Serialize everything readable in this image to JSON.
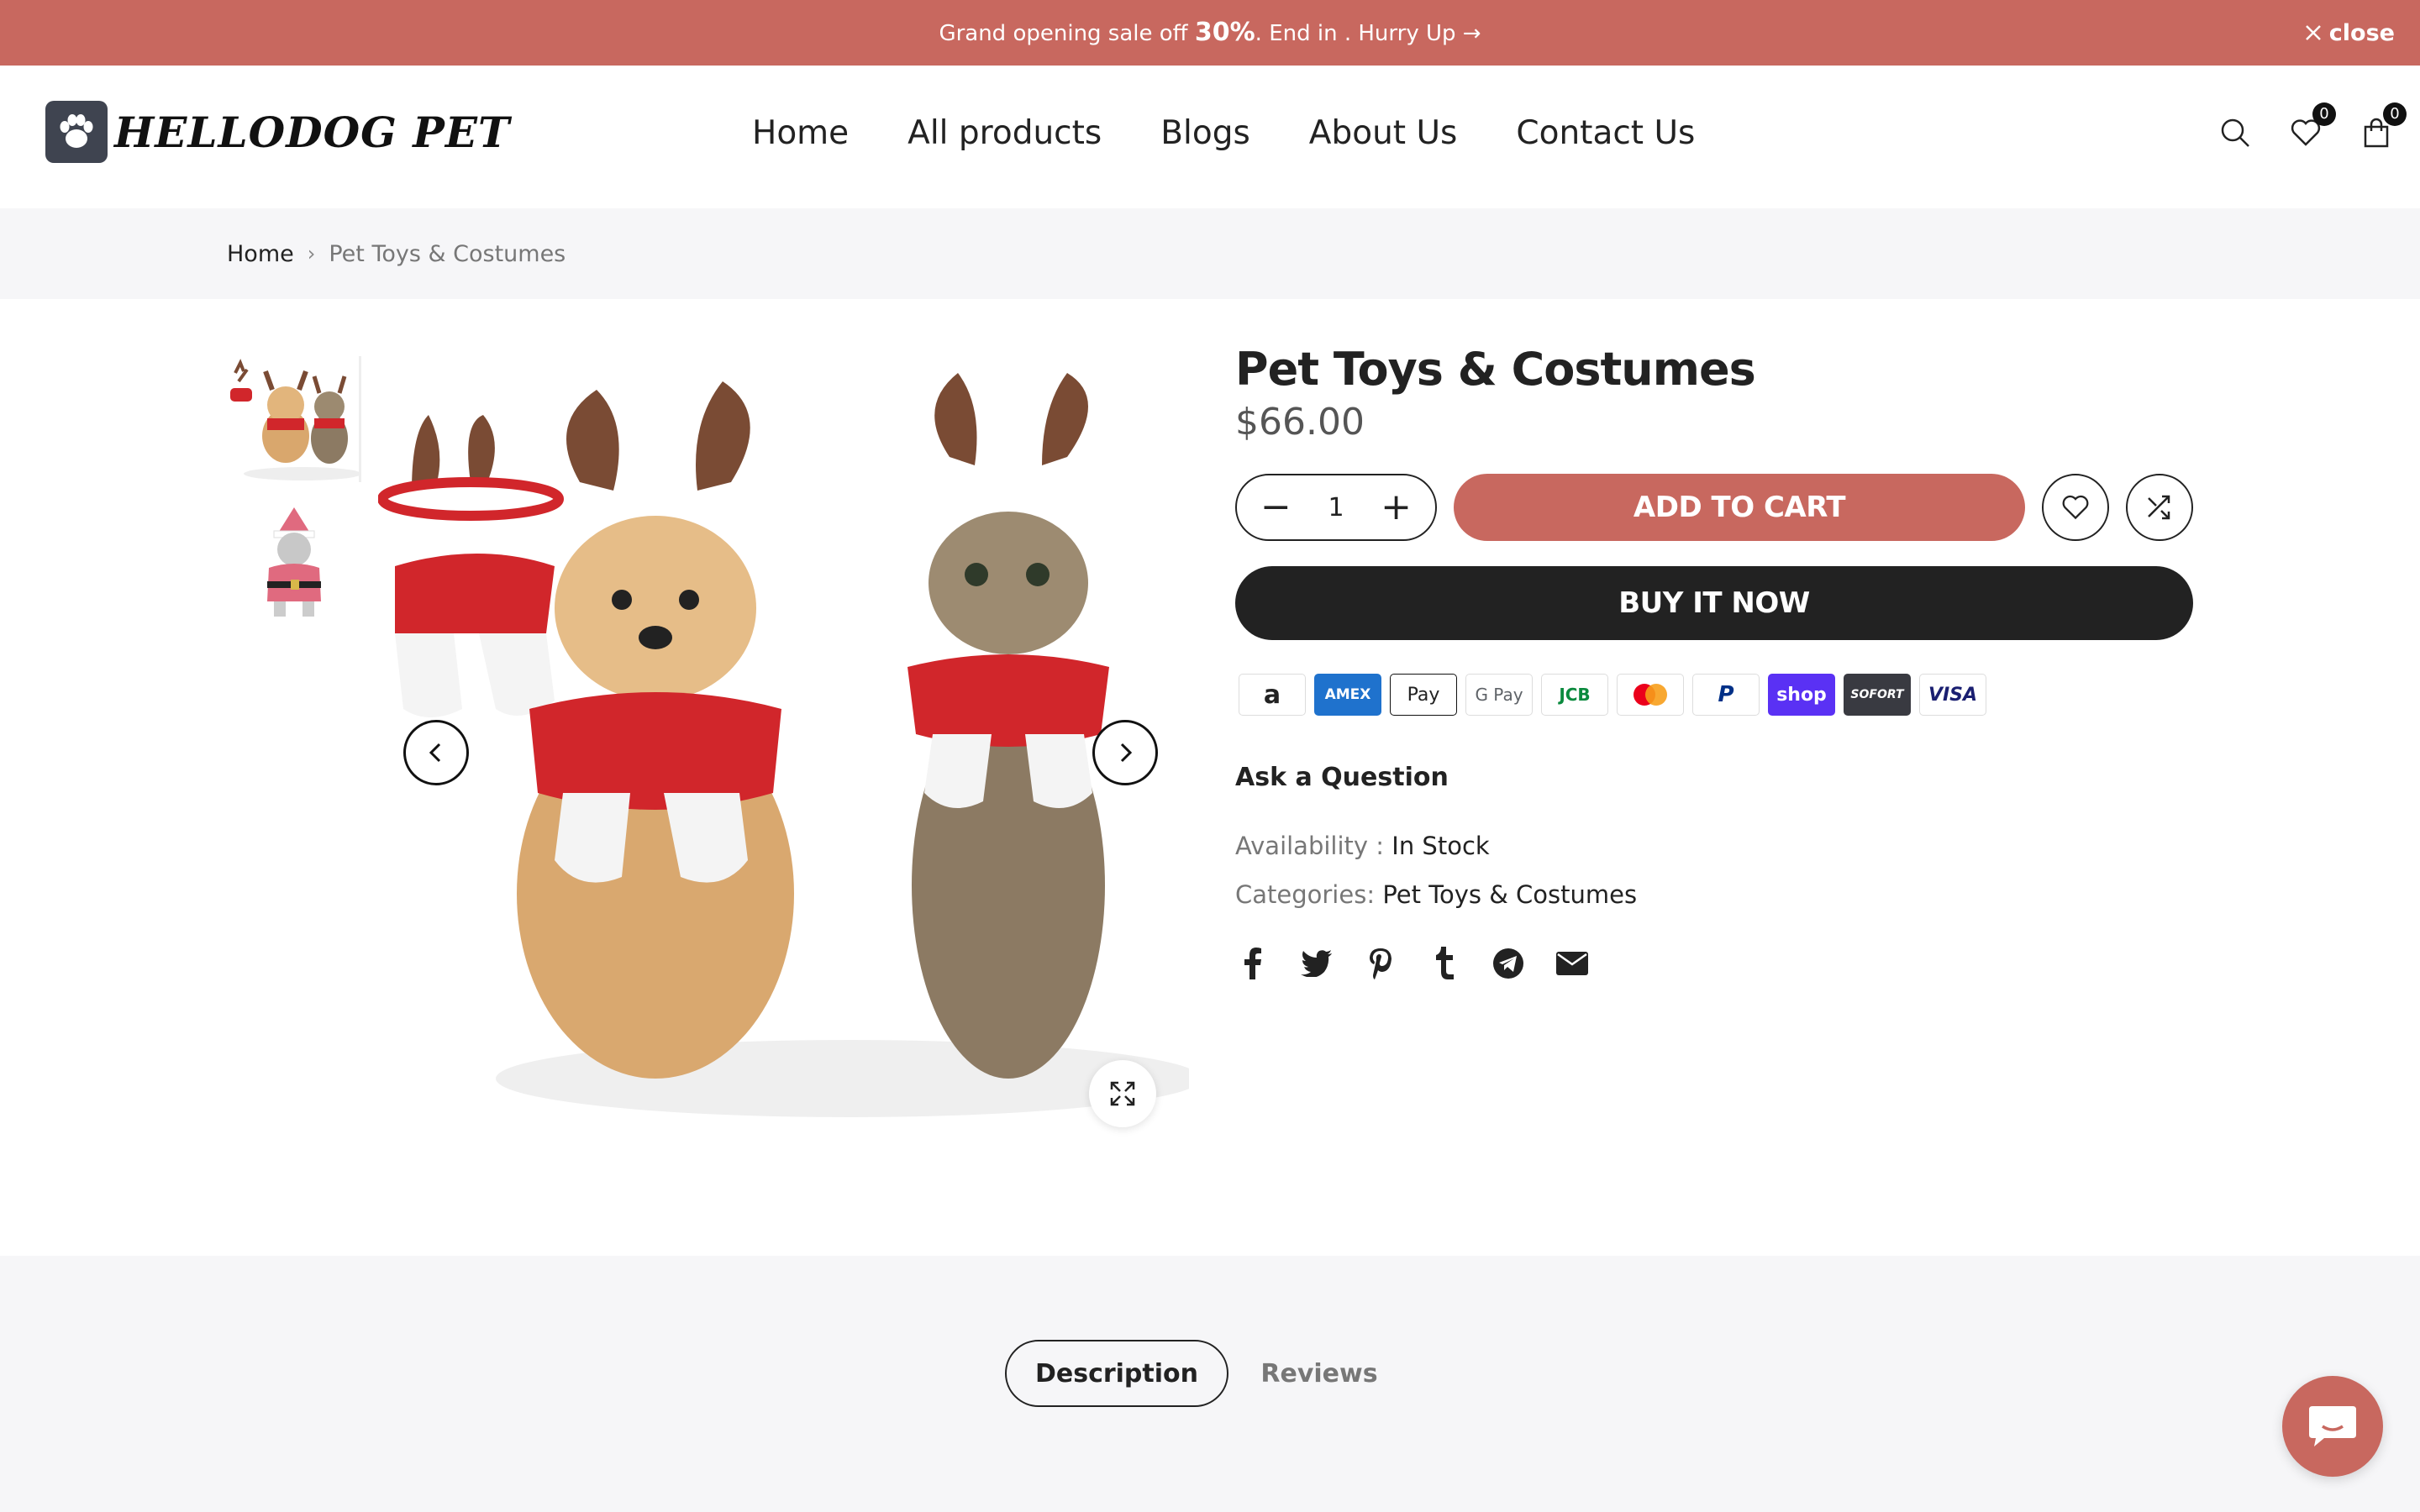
{
  "announcement": {
    "prefix": "Grand opening sale off ",
    "highlight": "30%",
    "suffix": ". End in . Hurry Up →",
    "close_label": "close"
  },
  "header": {
    "logo_text": "HELLODOG PET",
    "nav": [
      "Home",
      "All products",
      "Blogs",
      "About Us",
      "Contact Us"
    ],
    "wishlist_count": "0",
    "cart_count": "0"
  },
  "breadcrumb": {
    "home": "Home",
    "separator": "›",
    "current": "Pet Toys & Costumes"
  },
  "product": {
    "title": "Pet Toys & Costumes",
    "price": "$66.00",
    "quantity": "1",
    "qty_minus": "−",
    "qty_plus": "+",
    "add_to_cart": "ADD TO CART",
    "buy_now": "BUY IT NOW",
    "payment_methods": [
      "a",
      "AMEX",
      "Pay",
      "G Pay",
      "JCB",
      "",
      "P",
      "shop",
      "SOFORT",
      "VISA"
    ],
    "ask_question": "Ask a Question",
    "availability_label": "Availability : ",
    "availability_value": "In Stock",
    "categories_label": "Categories: ",
    "categories_value": "Pet Toys & Costumes"
  },
  "tabs": {
    "description": "Description",
    "reviews": "Reviews"
  },
  "colors": {
    "accent": "#c8685f",
    "dark": "#222222",
    "band": "#f6f6f8"
  }
}
